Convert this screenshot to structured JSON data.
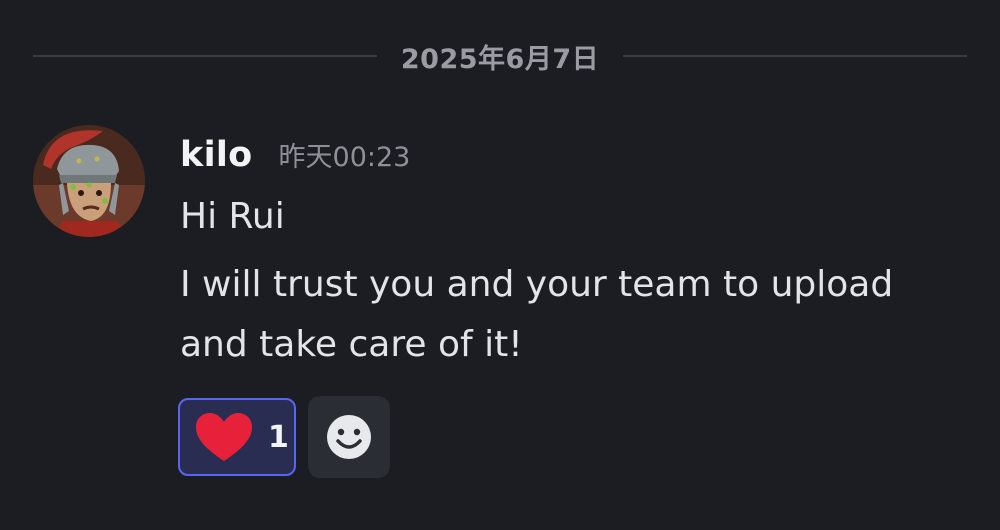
{
  "divider": {
    "date": "2025年6月7日"
  },
  "message": {
    "author": "kilo",
    "timestamp": "昨天00:23",
    "lines": [
      "Hi Rui",
      "I will trust you and your team to upload",
      "and take care of it!"
    ],
    "avatar_icon": "roman-soldier-avatar-icon"
  },
  "reactions": {
    "heart": {
      "emoji": "heart-icon",
      "count": "1",
      "color": "#e8213a"
    },
    "add_icon": "smiley-add-icon"
  },
  "colors": {
    "background": "#1c1d23",
    "accent": "#5865f2"
  }
}
